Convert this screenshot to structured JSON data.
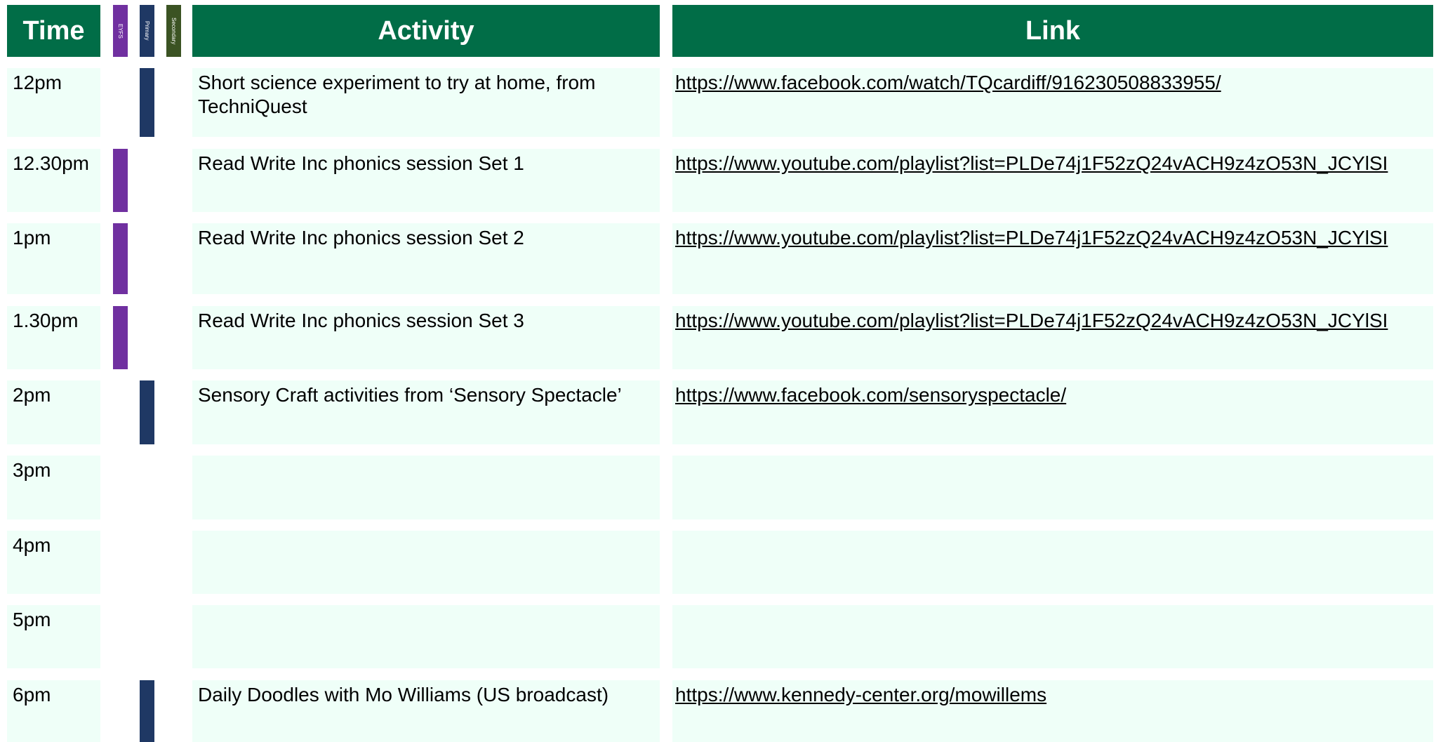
{
  "header": {
    "time": "Time",
    "eyfs": "EYFS",
    "primary": "Primary",
    "secondary": "Secondary",
    "activity": "Activity",
    "link": "Link"
  },
  "rows": [
    {
      "time": "12pm",
      "activity": "Short science experiment to try at home, from TechniQuest",
      "link": "https://www.facebook.com/watch/TQcardiff/916230508833955/",
      "eyfs": false,
      "primary": true,
      "secondary": false
    },
    {
      "time": "12.30pm",
      "activity": "Read Write Inc phonics session Set 1",
      "link": "https://www.youtube.com/playlist?list=PLDe74j1F52zQ24vACH9z4zO53N_JCYlSI",
      "eyfs": true,
      "primary": false,
      "secondary": false
    },
    {
      "time": "1pm",
      "activity": "Read Write Inc phonics session Set 2",
      "link": "https://www.youtube.com/playlist?list=PLDe74j1F52zQ24vACH9z4zO53N_JCYlSI",
      "eyfs": true,
      "primary": false,
      "secondary": false
    },
    {
      "time": "1.30pm",
      "activity": "Read Write Inc phonics session Set 3",
      "link": "https://www.youtube.com/playlist?list=PLDe74j1F52zQ24vACH9z4zO53N_JCYlSI",
      "eyfs": true,
      "primary": false,
      "secondary": false
    },
    {
      "time": "2pm",
      "activity": "Sensory Craft activities from ‘Sensory Spectacle’",
      "link": "https://www.facebook.com/sensoryspectacle/",
      "eyfs": false,
      "primary": true,
      "secondary": false
    },
    {
      "time": "3pm",
      "activity": "",
      "link": "",
      "eyfs": false,
      "primary": false,
      "secondary": false
    },
    {
      "time": "4pm",
      "activity": "",
      "link": "",
      "eyfs": false,
      "primary": false,
      "secondary": false
    },
    {
      "time": "5pm",
      "activity": "",
      "link": "",
      "eyfs": false,
      "primary": false,
      "secondary": false
    },
    {
      "time": "6pm",
      "activity": "Daily Doodles with Mo Williams (US broadcast)",
      "link": "https://www.kennedy-center.org/mowillems",
      "eyfs": false,
      "primary": true,
      "secondary": false
    }
  ],
  "colors": {
    "header": "#016d47",
    "eyfs": "#7030a0",
    "primary": "#1f3864",
    "secondary": "#3b5323",
    "cell": "#effff8"
  }
}
